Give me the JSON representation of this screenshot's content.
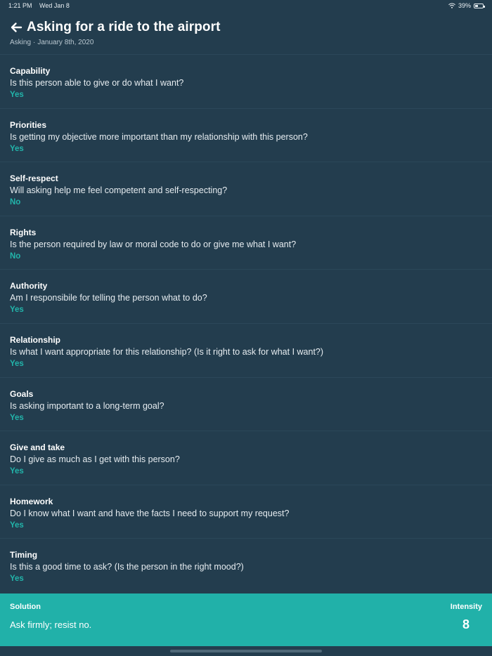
{
  "status_bar": {
    "time": "1:21 PM",
    "date": "Wed Jan 8",
    "battery_percent": "39%",
    "battery_level": 0.39,
    "wifi_icon": "wifi-icon",
    "battery_icon": "battery-icon"
  },
  "header": {
    "back_icon": "arrow-left-icon",
    "title": "Asking for a ride to the airport",
    "category": "Asking",
    "separator": "·",
    "date": "January 8th, 2020"
  },
  "criteria": [
    {
      "name": "Capability",
      "question": "Is this person able to give or do what I want?",
      "answer": "Yes"
    },
    {
      "name": "Priorities",
      "question": "Is getting my objective more important than my relationship with this person?",
      "answer": "Yes"
    },
    {
      "name": "Self-respect",
      "question": "Will asking help me feel competent and self-respecting?",
      "answer": "No"
    },
    {
      "name": "Rights",
      "question": "Is the person required by law or moral code to do or give me what I want?",
      "answer": "No"
    },
    {
      "name": "Authority",
      "question": "Am I responsibile for telling the person what to do?",
      "answer": "Yes"
    },
    {
      "name": "Relationship",
      "question": "Is what I want appropriate for this relationship? (Is it right to ask for what I want?)",
      "answer": "Yes"
    },
    {
      "name": "Goals",
      "question": "Is asking important to a long-term goal?",
      "answer": "Yes"
    },
    {
      "name": "Give and take",
      "question": "Do I give as much as I get with this person?",
      "answer": "Yes"
    },
    {
      "name": "Homework",
      "question": "Do I know what I want and have the facts I need to support my request?",
      "answer": "Yes"
    },
    {
      "name": "Timing",
      "question": "Is this a good time to ask? (Is the person in the right mood?)",
      "answer": "Yes"
    }
  ],
  "solution": {
    "label": "Solution",
    "text": "Ask firmly; resist no.",
    "intensity_label": "Intensity",
    "intensity_value": "8"
  },
  "colors": {
    "background": "#233d4e",
    "accent": "#22b4aa",
    "solution_panel": "#21b1a9"
  }
}
